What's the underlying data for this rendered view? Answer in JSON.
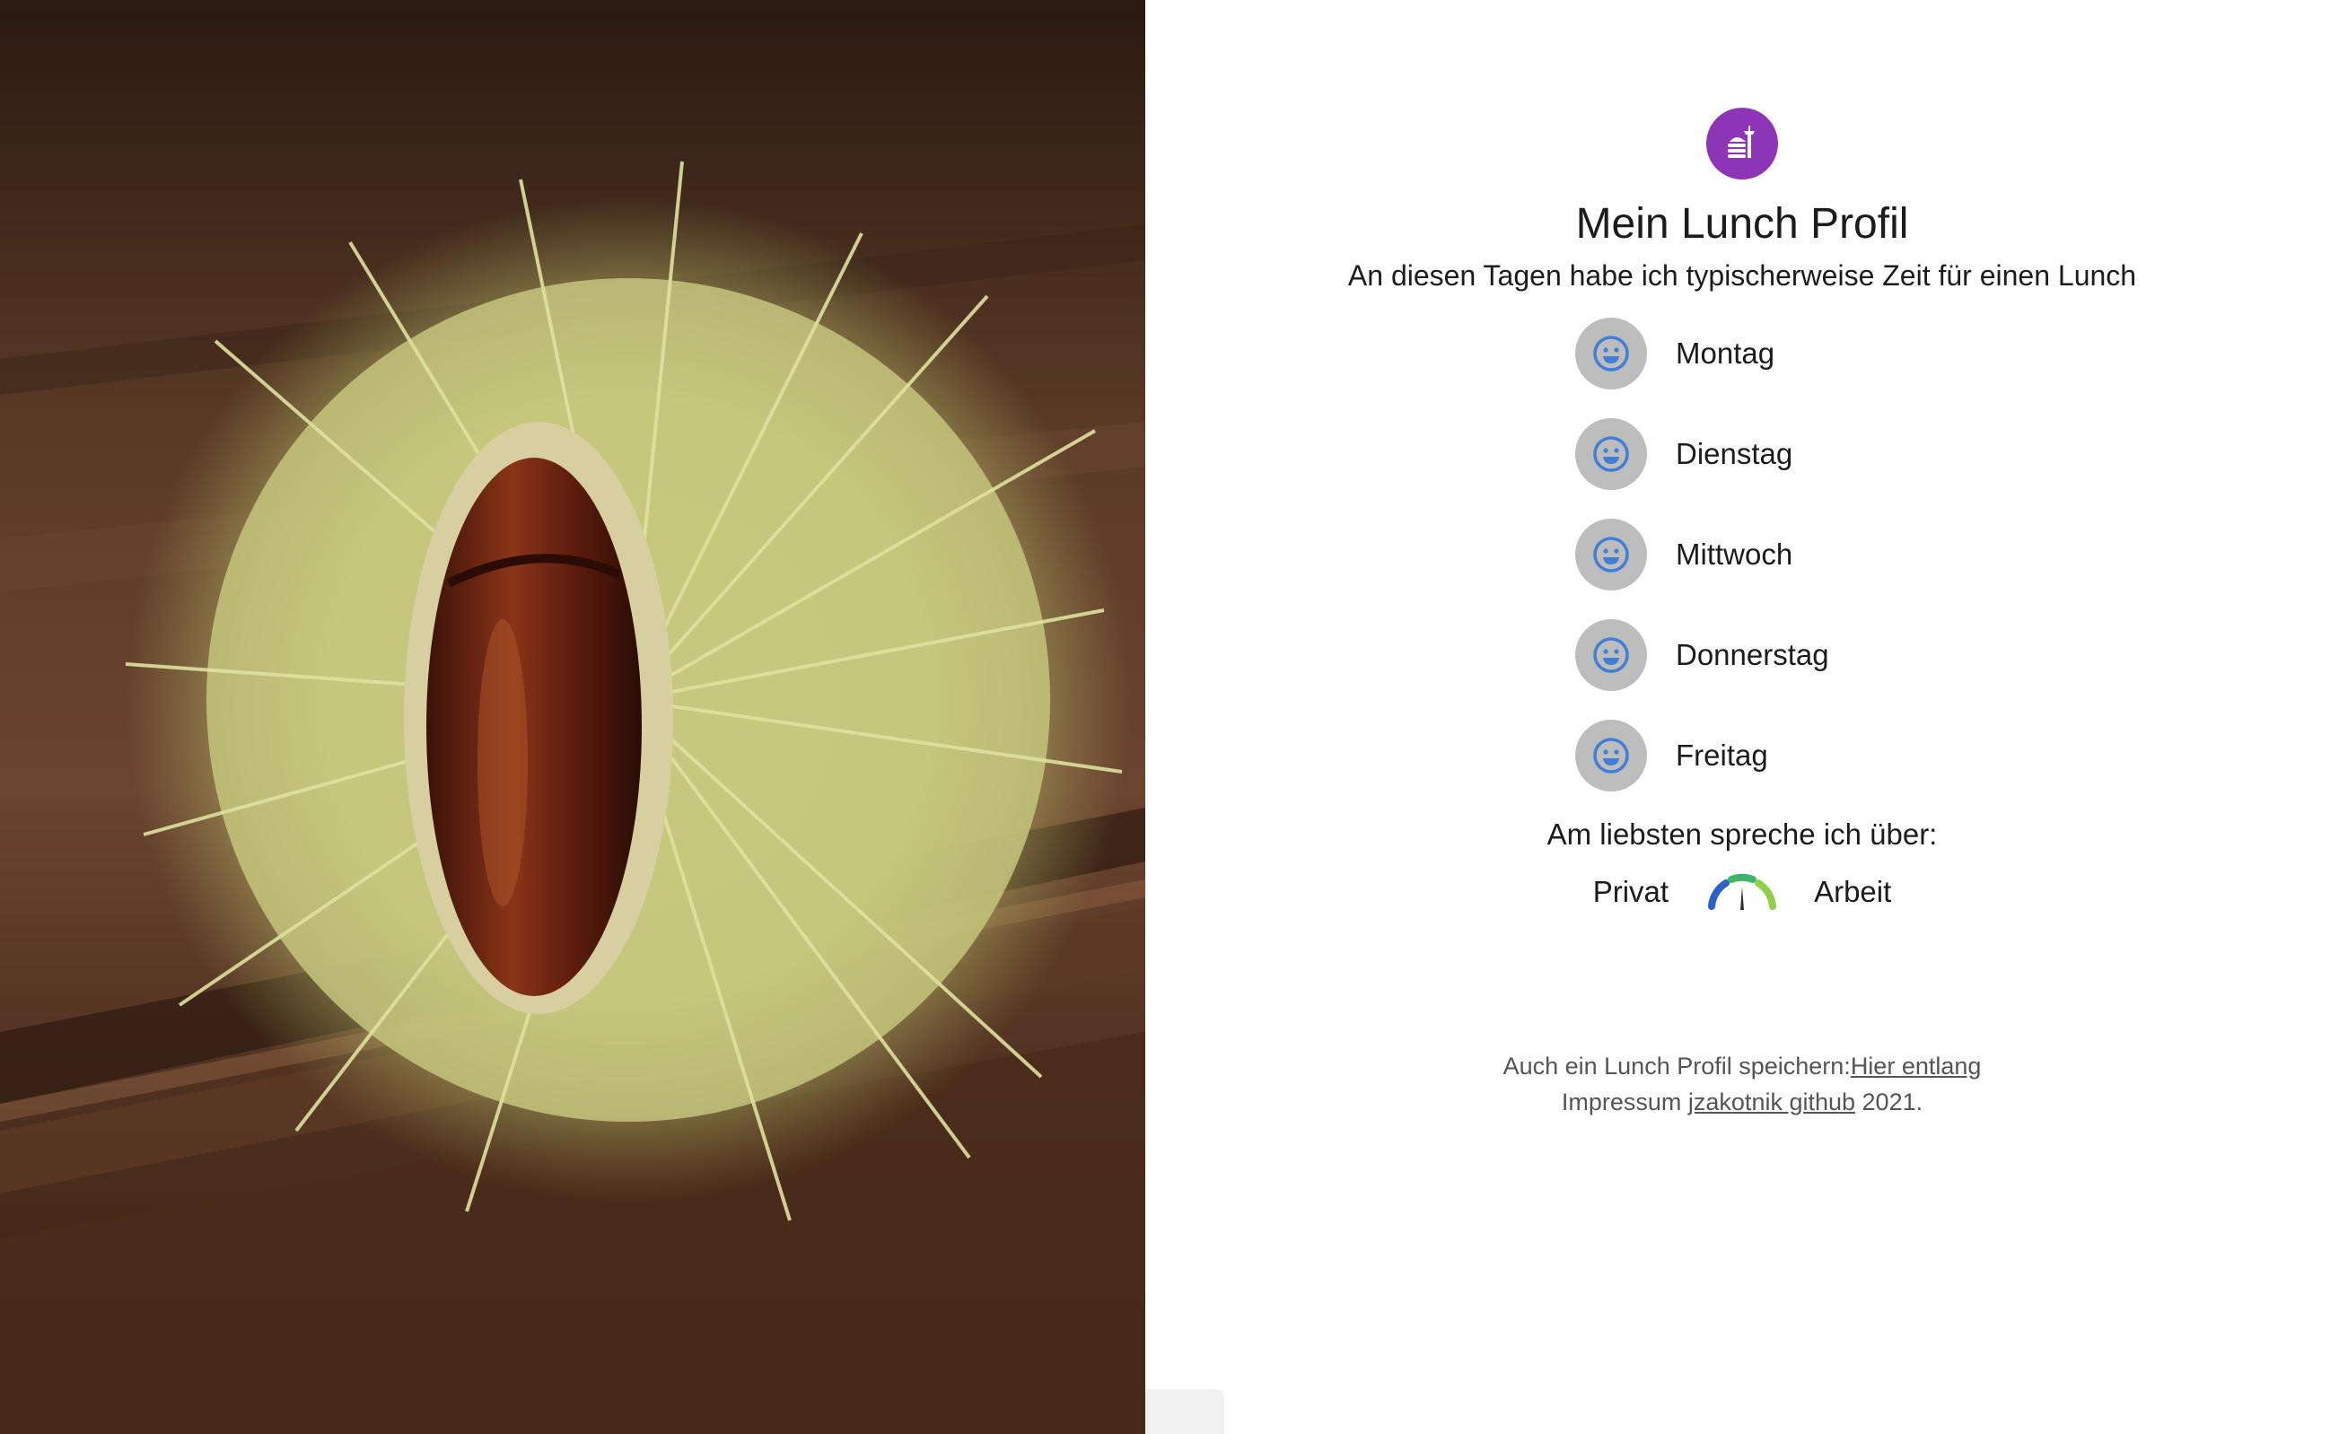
{
  "header": {
    "logo_icon": "lunch-food-icon",
    "brand_color": "#8e35b5",
    "title": "Mein Lunch Profil",
    "subtitle": "An diesen Tagen habe ich typischerweise Zeit für einen Lunch"
  },
  "days": [
    {
      "label": "Montag",
      "icon": "smiley-icon"
    },
    {
      "label": "Dienstag",
      "icon": "smiley-icon"
    },
    {
      "label": "Mittwoch",
      "icon": "smiley-icon"
    },
    {
      "label": "Donnerstag",
      "icon": "smiley-icon"
    },
    {
      "label": "Freitag",
      "icon": "smiley-icon"
    }
  ],
  "topics": {
    "question": "Am liebsten spreche ich über:",
    "left_label": "Privat",
    "right_label": "Arbeit",
    "gauge_icon": "gauge-icon"
  },
  "footer": {
    "line1_text": "Auch ein Lunch Profil speichern:",
    "line1_link": "Hier entlang",
    "line2_prefix": "Impressum ",
    "line2_link": "jzakotnik github",
    "line2_suffix": " 2021."
  },
  "colors": {
    "day_toggle_bg": "#bdbdbd",
    "smiley_color": "#3f7fd6"
  }
}
